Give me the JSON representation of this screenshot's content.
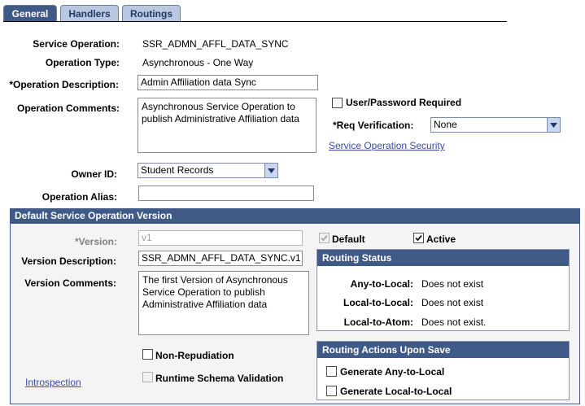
{
  "tabs": [
    {
      "label": "General",
      "active": true
    },
    {
      "label": "Handlers",
      "active": false
    },
    {
      "label": "Routings",
      "active": false
    }
  ],
  "form": {
    "service_operation_label": "Service Operation:",
    "service_operation_value": "SSR_ADMN_AFFL_DATA_SYNC",
    "operation_type_label": "Operation Type:",
    "operation_type_value": "Asynchronous - One Way",
    "operation_description_label": "*Operation Description:",
    "operation_description_value": "Admin Affiliation data Sync",
    "operation_comments_label": "Operation Comments:",
    "operation_comments_value": "Asynchronous Service Operation to publish Administrative Affiliation data",
    "user_password_label": "User/Password Required",
    "user_password_checked": false,
    "req_verification_label": "*Req Verification:",
    "req_verification_value": "None",
    "security_link": "Service Operation Security",
    "owner_id_label": "Owner ID:",
    "owner_id_value": "Student Records",
    "operation_alias_label": "Operation Alias:",
    "operation_alias_value": ""
  },
  "version_section": {
    "header": "Default Service Operation Version",
    "version_label": "*Version:",
    "version_value": "v1",
    "default_label": "Default",
    "default_checked": true,
    "active_label": "Active",
    "active_checked": true,
    "version_description_label": "Version Description:",
    "version_description_value": "SSR_ADMN_AFFL_DATA_SYNC.v1",
    "version_comments_label": "Version Comments:",
    "version_comments_value": "The first Version of Asynchronous Service Operation to publish Administrative Affiliation data",
    "non_repudiation_label": "Non-Repudiation",
    "non_repudiation_checked": false,
    "runtime_schema_label": "Runtime Schema Validation",
    "runtime_schema_checked": false,
    "introspection_link": "Introspection"
  },
  "routing_status": {
    "header": "Routing Status",
    "rows": [
      {
        "label": "Any-to-Local:",
        "value": "Does not exist"
      },
      {
        "label": "Local-to-Local:",
        "value": "Does not exist"
      },
      {
        "label": "Local-to-Atom:",
        "value": "Does not exist."
      }
    ]
  },
  "routing_actions": {
    "header": "Routing Actions Upon Save",
    "generate_any_label": "Generate Any-to-Local",
    "generate_any_checked": false,
    "generate_local_label": "Generate Local-to-Local",
    "generate_local_checked": false
  },
  "colors": {
    "header_blue": "#3f5a86",
    "tab_inactive": "#b8c8e0",
    "link": "#3d4aa8"
  }
}
